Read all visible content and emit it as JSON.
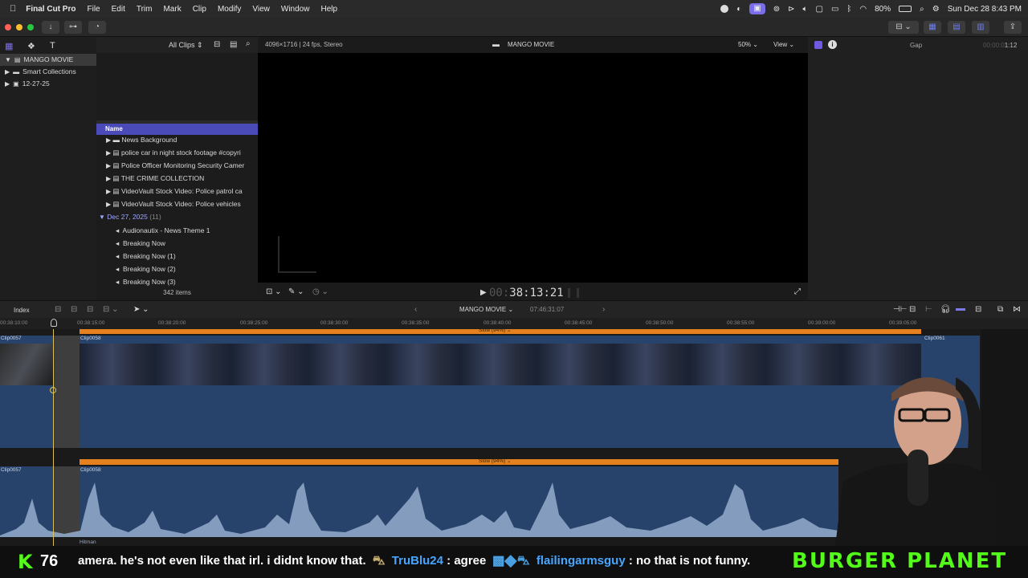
{
  "menubar": {
    "app": "Final Cut Pro",
    "items": [
      "File",
      "Edit",
      "Trim",
      "Mark",
      "Clip",
      "Modify",
      "View",
      "Window",
      "Help"
    ],
    "battery": "80%",
    "datetime": "Sun Dec 28  8:43 PM"
  },
  "library": {
    "name": "MANGO MOVIE",
    "items": [
      "Smart Collections",
      "12-27-25"
    ]
  },
  "browser": {
    "filter": "All Clips",
    "column": "Name",
    "rows": [
      "News Background",
      "police  car in night stock footage #copyri",
      "Police Officer Monitoring Security Camer",
      "THE CRIME COLLECTION",
      "VideoVault Stock Video:   Police patrol ca",
      "VideoVault Stock Video:   Police vehicles"
    ],
    "group_label": "Dec 27, 2025",
    "group_count": "(11)",
    "audio_rows": [
      "Audionautix - News Theme 1",
      "Breaking Now",
      "Breaking Now (1)",
      "Breaking Now (2)",
      "Breaking Now (3)"
    ],
    "item_count": "342 items"
  },
  "viewer": {
    "format": "4096×1716 | 24 fps, Stereo",
    "title": "MANGO MOVIE",
    "zoom": "50%",
    "view": "View",
    "timecode_dim": "00:",
    "timecode": "38:13:21"
  },
  "inspector": {
    "title": "Gap",
    "duration": "00:00:01:12"
  },
  "timeline": {
    "index": "Index",
    "project": "MANGO MOVIE",
    "duration": "07:46:31:07",
    "ruler": [
      "00:38:10:00",
      "00:38:15:00",
      "00:38:20:00",
      "00:38:25:00",
      "00:38:30:00",
      "00:38:35:00",
      "00:38:40:00",
      "00:38:45:00",
      "00:38:50:00",
      "00:38:55:00",
      "00:39:00:00",
      "00:39:05:00"
    ],
    "retime_label": "Slow (94%)",
    "clips": {
      "prev": "Clip0057",
      "main": "Clip0058",
      "next": "Clip0061"
    },
    "audio_sub": "Hitman"
  },
  "chat": {
    "kick_label": "K",
    "viewers": "76",
    "message_tail": "amera. he's not even like that irl. i didnt know that.",
    "user1": "TruBlu24",
    "msg1": ": agree",
    "user2": "flailingarmsguy",
    "msg2": ": no that is not funny.",
    "brand": "BURGER PLANET"
  },
  "colors": {
    "accent": "#5a5ae0",
    "retime": "#e5801e",
    "clip_blue": "#27436b",
    "audio_wave": "#8fa6c6",
    "kick_green": "#53fc18",
    "user_blue": "#47a6ff"
  }
}
